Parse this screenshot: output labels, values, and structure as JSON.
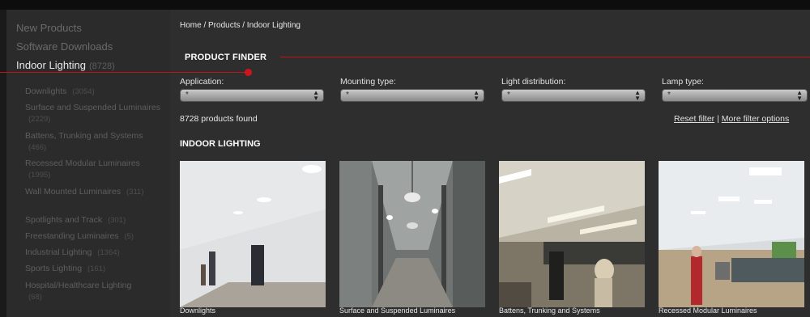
{
  "sidebar": {
    "top_items": [
      {
        "label": "New Products",
        "count": ""
      },
      {
        "label": "Software Downloads",
        "count": ""
      },
      {
        "label": "Indoor Lighting",
        "count": "(8728)"
      }
    ],
    "sub_items": [
      {
        "label": "Downlights",
        "count": "(3054)"
      },
      {
        "label": "Surface and Suspended Luminaires",
        "count": "(2229)"
      },
      {
        "label": "Battens, Trunking and Systems",
        "count": "(466)"
      },
      {
        "label": "Recessed Modular Luminaires",
        "count": "(1995)"
      },
      {
        "label": "Wall Mounted Luminaires",
        "count": "(311)"
      },
      {
        "label": "Spotlights and Track",
        "count": "(301)"
      },
      {
        "label": "Freestanding Luminaires",
        "count": "(5)"
      },
      {
        "label": "Industrial Lighting",
        "count": "(1364)"
      },
      {
        "label": "Sports Lighting",
        "count": "(161)"
      },
      {
        "label": "Hospital/Healthcare Lighting",
        "count": "(68)"
      }
    ]
  },
  "breadcrumb": "Home / Products / Indoor Lighting",
  "finder": {
    "title": "PRODUCT FINDER",
    "filters": [
      {
        "label": "Application:",
        "value": "*"
      },
      {
        "label": "Mounting type:",
        "value": "*"
      },
      {
        "label": "Light distribution:",
        "value": "*"
      },
      {
        "label": "Lamp type:",
        "value": "*"
      }
    ],
    "results_text": "8728 products found",
    "reset_label": "Reset filter",
    "separator": "|",
    "more_label": "More filter options"
  },
  "section_title": "INDOOR LIGHTING",
  "tiles": [
    {
      "label": "Downlights"
    },
    {
      "label": "Surface and Suspended Luminaires"
    },
    {
      "label": "Battens, Trunking and Systems"
    },
    {
      "label": "Recessed Modular Luminaires"
    }
  ],
  "colors": {
    "accent": "#c0141c",
    "background": "#2e2e2e",
    "sidebar": "#2b2b2b"
  },
  "icons": {
    "select_arrows": "updown-arrows-icon",
    "marker": "red-dot-icon"
  }
}
